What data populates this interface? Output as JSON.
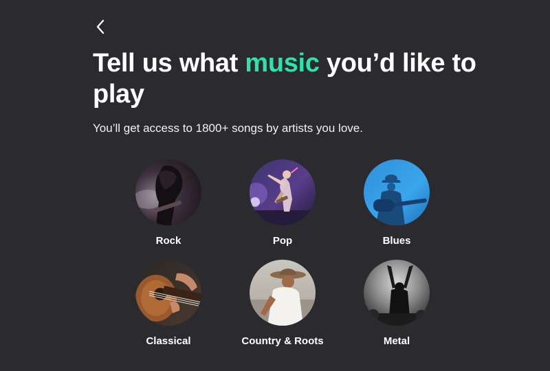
{
  "header": {
    "back_icon": "chevron-left-icon",
    "title_before": "Tell us what ",
    "title_accent": "music",
    "title_after": " you’d like to play",
    "subtitle": "You’ll get access to 1800+ songs by artists you love."
  },
  "colors": {
    "background": "#2a2a2f",
    "accent": "#2fe3a6",
    "text": "#ffffff"
  },
  "genres": [
    {
      "label": "Rock"
    },
    {
      "label": "Pop"
    },
    {
      "label": "Blues"
    },
    {
      "label": "Classical"
    },
    {
      "label": "Country & Roots"
    },
    {
      "label": "Metal"
    }
  ]
}
